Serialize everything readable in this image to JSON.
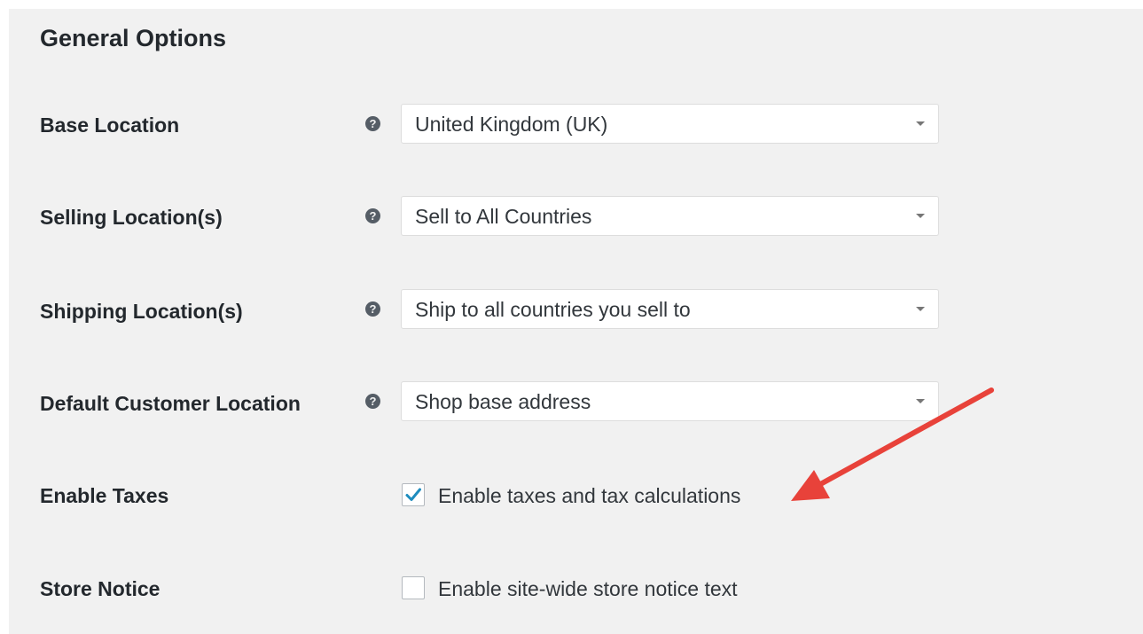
{
  "section": {
    "title": "General Options"
  },
  "rows": [
    {
      "label": "Base Location",
      "type": "select",
      "value": "United Kingdom (UK)"
    },
    {
      "label": "Selling Location(s)",
      "type": "select",
      "value": "Sell to All Countries"
    },
    {
      "label": "Shipping Location(s)",
      "type": "select",
      "value": "Ship to all countries you sell to"
    },
    {
      "label": "Default Customer Location",
      "type": "select",
      "value": "Shop base address"
    },
    {
      "label": "Enable Taxes",
      "type": "checkbox",
      "checked": true,
      "option_label": "Enable taxes and tax calculations"
    },
    {
      "label": "Store Notice",
      "type": "checkbox",
      "checked": false,
      "option_label": "Enable site-wide store notice text"
    }
  ],
  "icons": {
    "help": "help-icon",
    "dropdown": "chevron-down-icon",
    "check": "checkmark-icon",
    "annotation": "red-arrow-icon"
  },
  "colors": {
    "panel_background": "#f1f1f1",
    "checkmark": "#1e8cbe",
    "annotation_arrow": "#e8423a"
  }
}
